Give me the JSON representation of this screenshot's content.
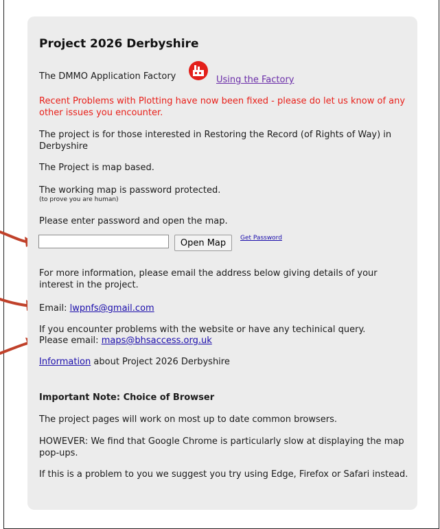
{
  "heading": "Project 2026 Derbyshire",
  "factory": {
    "label": "The DMMO Application Factory",
    "icon": "factory-icon",
    "link": "Using the Factory"
  },
  "notice": "Recent Problems with Plotting have now been fixed - please do let us know of any other issues you encounter.",
  "intro": "The project is for those interested in Restoring the Record (of Rights of Way) in Derbyshire",
  "map_based": "The Project is map based.",
  "protected": "The working map is password protected.",
  "protected_note": "(to prove you are human)",
  "enter_prompt": "Please enter password and open the map.",
  "password_field": {
    "value": "",
    "placeholder": ""
  },
  "open_map_button": "Open Map",
  "get_password_link": "Get Password",
  "more_info": "For more information, please email the address below giving details of your interest in the project.",
  "email_label": "Email:",
  "email": "lwpnfs@gmail.com",
  "problems_text": "If you encounter problems with the website or have any techinical query.",
  "please_email_label": "Please email:",
  "tech_email": "maps@bhsaccess.org.uk",
  "info_link": "Information",
  "info_suffix": "about Project 2026 Derbyshire",
  "important_heading": "Important Note: Choice of Browser",
  "browser_p1": "The project pages will work on most up to date common browsers.",
  "browser_p2": "HOWEVER: We find that Google Chrome is particularly slow at displaying the map pop-ups.",
  "browser_p3": "If this is a problem to you we suggest you try using Edge, Firefox or Safari instead.",
  "colors": {
    "card": "#ececec",
    "notice": "#e8201a",
    "link": "#1a0dab",
    "visited": "#6a2da8",
    "arrow": "#c0412a"
  }
}
